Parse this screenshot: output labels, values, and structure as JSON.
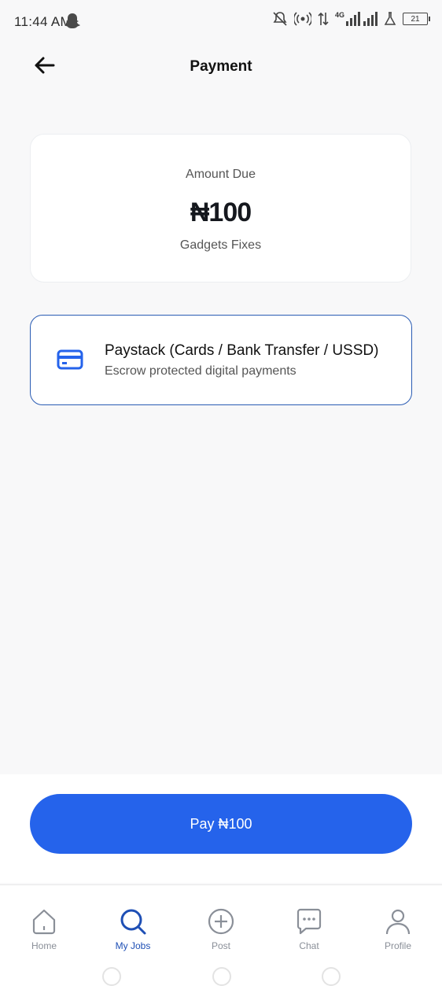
{
  "status_bar": {
    "time": "11:44 AM",
    "battery": "21",
    "network": "4G"
  },
  "header": {
    "title": "Payment"
  },
  "amount_card": {
    "label": "Amount Due",
    "amount": "₦100",
    "description": "Gadgets Fixes"
  },
  "payment_method": {
    "title": "Paystack (Cards / Bank Transfer / USSD)",
    "subtitle": "Escrow protected digital payments"
  },
  "pay_button": {
    "label": "Pay ₦100"
  },
  "bottom_nav": {
    "items": [
      {
        "label": "Home",
        "icon": "home-icon"
      },
      {
        "label": "My Jobs",
        "icon": "search-icon",
        "active": true
      },
      {
        "label": "Post",
        "icon": "plus-circle-icon"
      },
      {
        "label": "Chat",
        "icon": "chat-icon"
      },
      {
        "label": "Profile",
        "icon": "person-icon"
      }
    ]
  },
  "colors": {
    "accent": "#2563eb",
    "card_border": "#2a5cb3",
    "active_nav": "#1e4fb5"
  }
}
